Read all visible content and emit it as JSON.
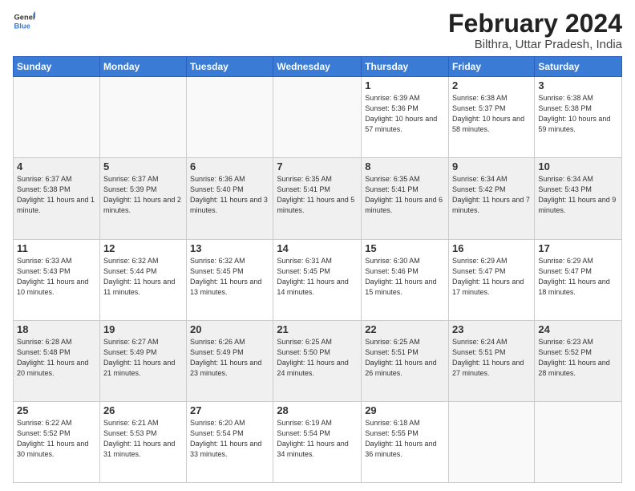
{
  "logo": {
    "text_general": "General",
    "text_blue": "Blue"
  },
  "title": "February 2024",
  "subtitle": "Bilthra, Uttar Pradesh, India",
  "headers": [
    "Sunday",
    "Monday",
    "Tuesday",
    "Wednesday",
    "Thursday",
    "Friday",
    "Saturday"
  ],
  "weeks": [
    [
      {
        "day": "",
        "info": ""
      },
      {
        "day": "",
        "info": ""
      },
      {
        "day": "",
        "info": ""
      },
      {
        "day": "",
        "info": ""
      },
      {
        "day": "1",
        "info": "Sunrise: 6:39 AM\nSunset: 5:36 PM\nDaylight: 10 hours and 57 minutes."
      },
      {
        "day": "2",
        "info": "Sunrise: 6:38 AM\nSunset: 5:37 PM\nDaylight: 10 hours and 58 minutes."
      },
      {
        "day": "3",
        "info": "Sunrise: 6:38 AM\nSunset: 5:38 PM\nDaylight: 10 hours and 59 minutes."
      }
    ],
    [
      {
        "day": "4",
        "info": "Sunrise: 6:37 AM\nSunset: 5:38 PM\nDaylight: 11 hours and 1 minute."
      },
      {
        "day": "5",
        "info": "Sunrise: 6:37 AM\nSunset: 5:39 PM\nDaylight: 11 hours and 2 minutes."
      },
      {
        "day": "6",
        "info": "Sunrise: 6:36 AM\nSunset: 5:40 PM\nDaylight: 11 hours and 3 minutes."
      },
      {
        "day": "7",
        "info": "Sunrise: 6:35 AM\nSunset: 5:41 PM\nDaylight: 11 hours and 5 minutes."
      },
      {
        "day": "8",
        "info": "Sunrise: 6:35 AM\nSunset: 5:41 PM\nDaylight: 11 hours and 6 minutes."
      },
      {
        "day": "9",
        "info": "Sunrise: 6:34 AM\nSunset: 5:42 PM\nDaylight: 11 hours and 7 minutes."
      },
      {
        "day": "10",
        "info": "Sunrise: 6:34 AM\nSunset: 5:43 PM\nDaylight: 11 hours and 9 minutes."
      }
    ],
    [
      {
        "day": "11",
        "info": "Sunrise: 6:33 AM\nSunset: 5:43 PM\nDaylight: 11 hours and 10 minutes."
      },
      {
        "day": "12",
        "info": "Sunrise: 6:32 AM\nSunset: 5:44 PM\nDaylight: 11 hours and 11 minutes."
      },
      {
        "day": "13",
        "info": "Sunrise: 6:32 AM\nSunset: 5:45 PM\nDaylight: 11 hours and 13 minutes."
      },
      {
        "day": "14",
        "info": "Sunrise: 6:31 AM\nSunset: 5:45 PM\nDaylight: 11 hours and 14 minutes."
      },
      {
        "day": "15",
        "info": "Sunrise: 6:30 AM\nSunset: 5:46 PM\nDaylight: 11 hours and 15 minutes."
      },
      {
        "day": "16",
        "info": "Sunrise: 6:29 AM\nSunset: 5:47 PM\nDaylight: 11 hours and 17 minutes."
      },
      {
        "day": "17",
        "info": "Sunrise: 6:29 AM\nSunset: 5:47 PM\nDaylight: 11 hours and 18 minutes."
      }
    ],
    [
      {
        "day": "18",
        "info": "Sunrise: 6:28 AM\nSunset: 5:48 PM\nDaylight: 11 hours and 20 minutes."
      },
      {
        "day": "19",
        "info": "Sunrise: 6:27 AM\nSunset: 5:49 PM\nDaylight: 11 hours and 21 minutes."
      },
      {
        "day": "20",
        "info": "Sunrise: 6:26 AM\nSunset: 5:49 PM\nDaylight: 11 hours and 23 minutes."
      },
      {
        "day": "21",
        "info": "Sunrise: 6:25 AM\nSunset: 5:50 PM\nDaylight: 11 hours and 24 minutes."
      },
      {
        "day": "22",
        "info": "Sunrise: 6:25 AM\nSunset: 5:51 PM\nDaylight: 11 hours and 26 minutes."
      },
      {
        "day": "23",
        "info": "Sunrise: 6:24 AM\nSunset: 5:51 PM\nDaylight: 11 hours and 27 minutes."
      },
      {
        "day": "24",
        "info": "Sunrise: 6:23 AM\nSunset: 5:52 PM\nDaylight: 11 hours and 28 minutes."
      }
    ],
    [
      {
        "day": "25",
        "info": "Sunrise: 6:22 AM\nSunset: 5:52 PM\nDaylight: 11 hours and 30 minutes."
      },
      {
        "day": "26",
        "info": "Sunrise: 6:21 AM\nSunset: 5:53 PM\nDaylight: 11 hours and 31 minutes."
      },
      {
        "day": "27",
        "info": "Sunrise: 6:20 AM\nSunset: 5:54 PM\nDaylight: 11 hours and 33 minutes."
      },
      {
        "day": "28",
        "info": "Sunrise: 6:19 AM\nSunset: 5:54 PM\nDaylight: 11 hours and 34 minutes."
      },
      {
        "day": "29",
        "info": "Sunrise: 6:18 AM\nSunset: 5:55 PM\nDaylight: 11 hours and 36 minutes."
      },
      {
        "day": "",
        "info": ""
      },
      {
        "day": "",
        "info": ""
      }
    ]
  ]
}
